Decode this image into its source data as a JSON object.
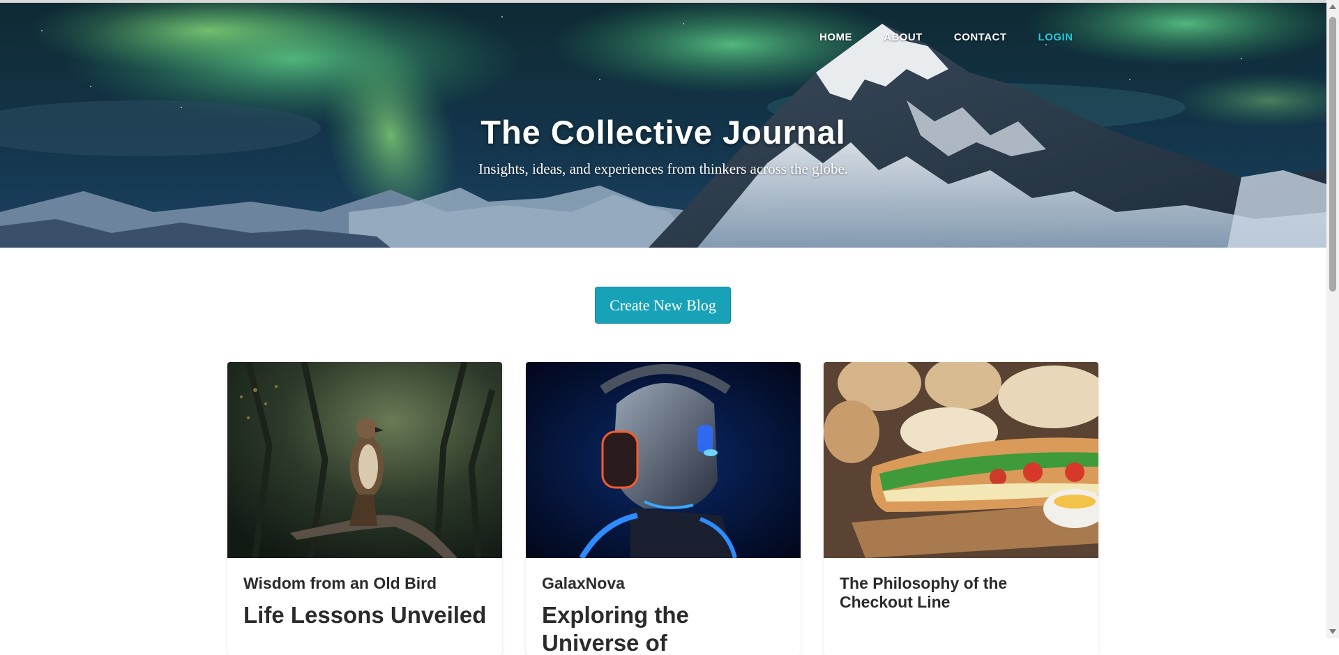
{
  "nav": {
    "items": [
      {
        "label": "HOME"
      },
      {
        "label": "ABOUT"
      },
      {
        "label": "CONTACT"
      },
      {
        "label": "LOGIN"
      }
    ]
  },
  "hero": {
    "title": "The Collective Journal",
    "subtitle": "Insights, ideas, and experiences from thinkers across the globe."
  },
  "cta": {
    "label": "Create New Blog"
  },
  "cards": [
    {
      "author": "Wisdom from an Old Bird",
      "headline": "Life Lessons Unveiled"
    },
    {
      "author": "GalaxNova",
      "headline": "Exploring the Universe of"
    },
    {
      "author": "The Philosophy of the Checkout Line",
      "headline": ""
    }
  ],
  "colors": {
    "accent": "#17a2b8",
    "login": "#25cbe0",
    "text_dark": "#2b2b2b"
  }
}
